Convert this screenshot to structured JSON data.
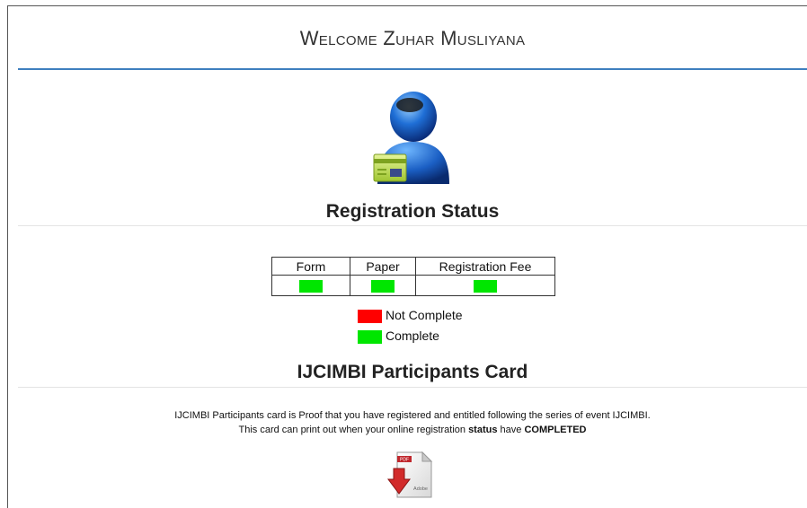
{
  "header": {
    "welcome_text": "Welcome Zuhar Musliyana"
  },
  "registration": {
    "title": "Registration Status",
    "columns": [
      "Form",
      "Paper",
      "Registration Fee"
    ],
    "statuses": [
      "complete",
      "complete",
      "complete"
    ]
  },
  "legend": {
    "not_complete_label": "Not Complete",
    "complete_label": "Complete",
    "not_complete_color": "#ff0000",
    "complete_color": "#00e600"
  },
  "card": {
    "title": "IJCIMBI Participants Card",
    "line1": "IJCIMBI Participants card is Proof that you have registered and entitled following the series of event IJCIMBI.",
    "line2_prefix": "This card can print out when your online registration ",
    "line2_status": "status",
    "line2_middle": " have ",
    "line2_completed": "COMPLETED",
    "pdf_badge": "PDF",
    "pdf_brand": "Adobe"
  },
  "icons": {
    "avatar": "user-card-icon",
    "pdf": "pdf-download-icon"
  }
}
